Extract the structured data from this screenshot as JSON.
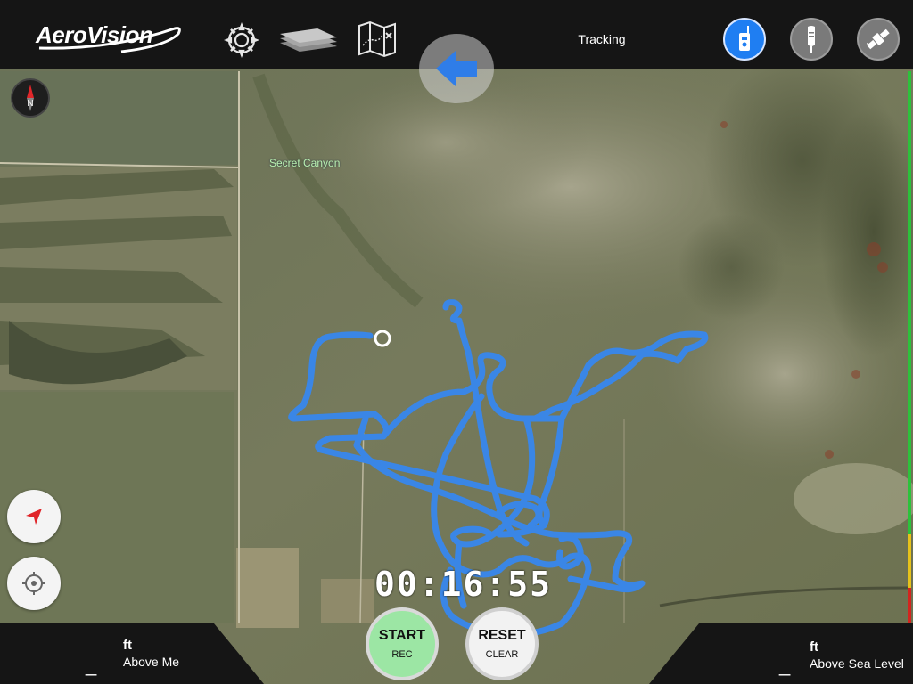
{
  "app": {
    "logo_text": "AeroVision",
    "status_label": "Tracking"
  },
  "toolbar": {
    "icons": [
      "gear-icon",
      "layers-icon",
      "map-icon"
    ],
    "modes": [
      {
        "name": "controller-mode",
        "active": true
      },
      {
        "name": "beacon-mode",
        "active": false
      },
      {
        "name": "satellite-mode",
        "active": false
      }
    ]
  },
  "map": {
    "place_label": "Secret Canyon"
  },
  "timer": {
    "value": "00:16:55"
  },
  "controls": {
    "start_label": "START",
    "start_sub": "REC",
    "reset_label": "RESET",
    "reset_sub": "CLEAR"
  },
  "altitude_left": {
    "value": "_",
    "unit": "ft",
    "label": "Above Me"
  },
  "altitude_right": {
    "value": "_",
    "unit": "ft",
    "label": "Above Sea Level"
  },
  "colors": {
    "track": "#3a86e6",
    "accent": "#1f7ef2",
    "start": "#9ce6a4",
    "bar": "#151515"
  }
}
